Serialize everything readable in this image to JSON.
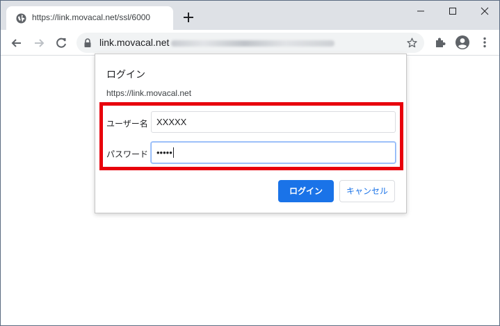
{
  "tab": {
    "title": "https://link.movacal.net/ssl/6000",
    "icon": "globe-icon"
  },
  "toolbar": {
    "url": "link.movacal.net",
    "icons": [
      "back-icon",
      "forward-icon",
      "reload-icon",
      "lock-icon",
      "star-icon",
      "extensions-icon",
      "account-icon",
      "menu-icon"
    ]
  },
  "window_controls": [
    "minimize-icon",
    "maximize-icon",
    "close-icon"
  ],
  "dialog": {
    "title": "ログイン",
    "origin": "https://link.movacal.net",
    "username_label": "ユーザー名",
    "username_value": "XXXXX",
    "password_label": "パスワード",
    "password_value": "•••••",
    "login_button": "ログイン",
    "cancel_button": "キャンセル"
  },
  "colors": {
    "accent": "#1a73e8",
    "highlight": "#e8000c",
    "titlebar": "#dee1e6"
  }
}
